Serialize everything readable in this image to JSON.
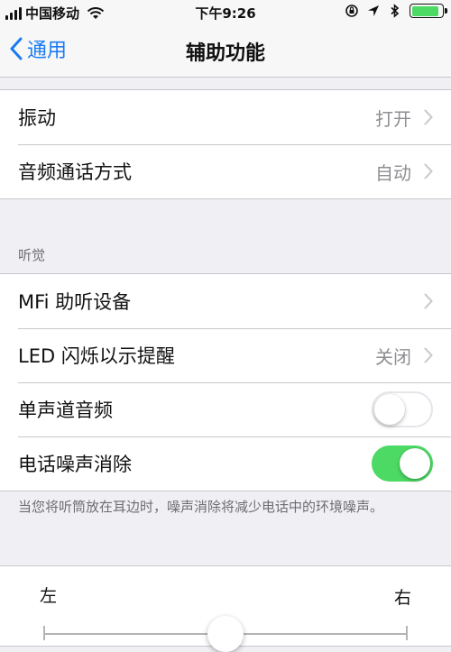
{
  "status_bar": {
    "carrier": "中国移动",
    "time": "下午9:26",
    "battery_level": 0.9,
    "battery_color": "#4cd964"
  },
  "nav": {
    "back_label": "通用",
    "title": "辅助功能"
  },
  "group_top": {
    "rows": [
      {
        "label": "振动",
        "value": "打开"
      },
      {
        "label": "音频通话方式",
        "value": "自动"
      }
    ]
  },
  "hearing": {
    "header": "听觉",
    "rows": [
      {
        "label": "MFi 助听设备",
        "value": ""
      },
      {
        "label": "LED 闪烁以示提醒",
        "value": "关闭"
      },
      {
        "label": "单声道音频",
        "toggle": false
      },
      {
        "label": "电话噪声消除",
        "toggle": true
      }
    ],
    "footer": "当您将听筒放在耳边时，噪声消除将减少电话中的环境噪声。"
  },
  "balance": {
    "left_label": "左",
    "right_label": "右",
    "value": 0.5
  },
  "colors": {
    "accent": "#1a7bf2",
    "toggle_on": "#4cd964",
    "background": "#efeff4"
  }
}
